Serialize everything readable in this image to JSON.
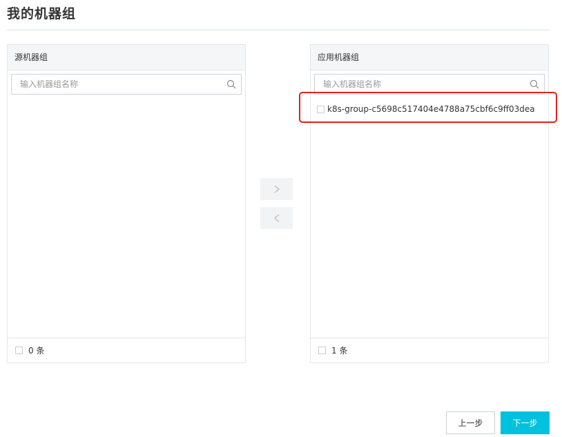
{
  "page": {
    "title": "我的机器组"
  },
  "source_panel": {
    "title": "源机器组",
    "search_placeholder": "输入机器组名称",
    "items": [],
    "count_label": "0 条"
  },
  "target_panel": {
    "title": "应用机器组",
    "search_placeholder": "输入机器组名称",
    "items": [
      {
        "label": "k8s-group-c5698c517404e4788a75cbf6c9ff03dea"
      }
    ],
    "count_label": "1 条"
  },
  "transfer": {
    "to_right_icon": "chevron-right-icon",
    "to_left_icon": "chevron-left-icon"
  },
  "footer": {
    "prev_label": "上一步",
    "next_label": "下一步"
  },
  "colors": {
    "accent": "#00c1de",
    "highlight": "#e0201c"
  }
}
